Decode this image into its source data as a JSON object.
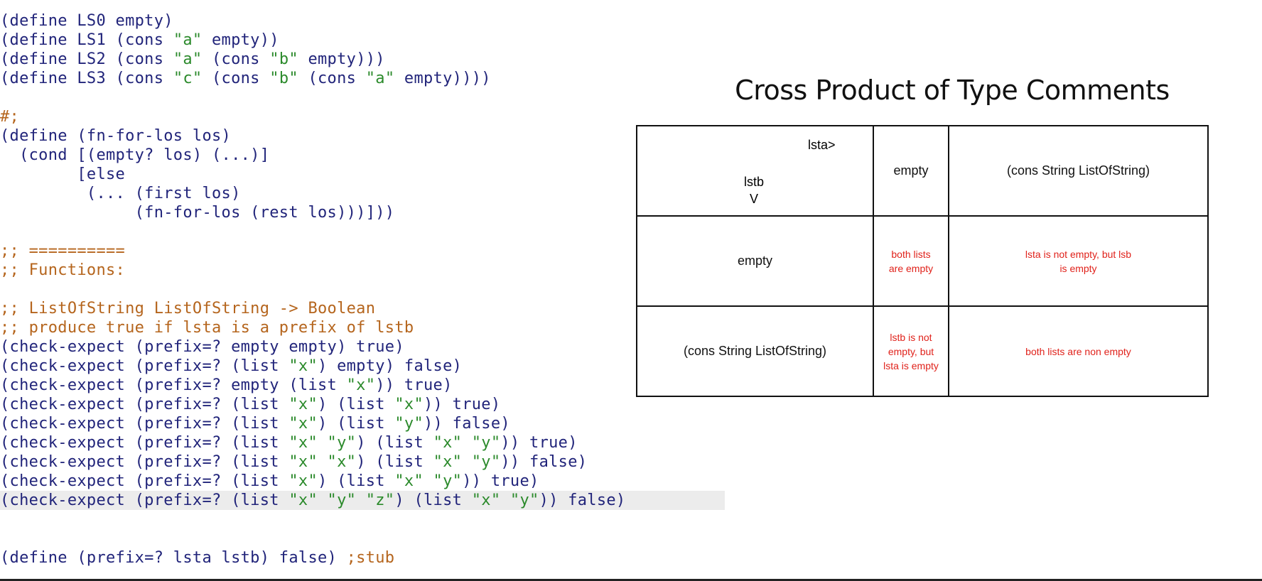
{
  "editor": {
    "lines": [
      [
        {
          "t": "(define LS0 empty)",
          "k": "n"
        }
      ],
      [
        {
          "t": "(define LS1 (cons ",
          "k": "n"
        },
        {
          "t": "\"a\"",
          "k": "s"
        },
        {
          "t": " empty))",
          "k": "n"
        }
      ],
      [
        {
          "t": "(define LS2 (cons ",
          "k": "n"
        },
        {
          "t": "\"a\"",
          "k": "s"
        },
        {
          "t": " (cons ",
          "k": "n"
        },
        {
          "t": "\"b\"",
          "k": "s"
        },
        {
          "t": " empty)))",
          "k": "n"
        }
      ],
      [
        {
          "t": "(define LS3 (cons ",
          "k": "n"
        },
        {
          "t": "\"c\"",
          "k": "s"
        },
        {
          "t": " (cons ",
          "k": "n"
        },
        {
          "t": "\"b\"",
          "k": "s"
        },
        {
          "t": " (cons ",
          "k": "n"
        },
        {
          "t": "\"a\"",
          "k": "s"
        },
        {
          "t": " empty))))",
          "k": "n"
        }
      ],
      [],
      [
        {
          "t": "#;",
          "k": "c"
        }
      ],
      [
        {
          "t": "(define (fn-for-los los)",
          "k": "n"
        }
      ],
      [
        {
          "t": "  (cond [(empty? los) (...)]",
          "k": "n"
        }
      ],
      [
        {
          "t": "        [else",
          "k": "n"
        }
      ],
      [
        {
          "t": "         (... (first los)",
          "k": "n"
        }
      ],
      [
        {
          "t": "              (fn-for-los (rest los)))]))",
          "k": "n"
        }
      ],
      [],
      [
        {
          "t": ";; ==========",
          "k": "c"
        }
      ],
      [
        {
          "t": ";; Functions:",
          "k": "c"
        }
      ],
      [],
      [
        {
          "t": ";; ListOfString ListOfString -> Boolean",
          "k": "c"
        }
      ],
      [
        {
          "t": ";; produce true if lsta is a prefix of lstb",
          "k": "c"
        }
      ],
      [
        {
          "t": "(check-expect (prefix=? empty empty) true)",
          "k": "n"
        }
      ],
      [
        {
          "t": "(check-expect (prefix=? (list ",
          "k": "n"
        },
        {
          "t": "\"x\"",
          "k": "s"
        },
        {
          "t": ") empty) false)",
          "k": "n"
        }
      ],
      [
        {
          "t": "(check-expect (prefix=? empty (list ",
          "k": "n"
        },
        {
          "t": "\"x\"",
          "k": "s"
        },
        {
          "t": ")) true)",
          "k": "n"
        }
      ],
      [
        {
          "t": "(check-expect (prefix=? (list ",
          "k": "n"
        },
        {
          "t": "\"x\"",
          "k": "s"
        },
        {
          "t": ") (list ",
          "k": "n"
        },
        {
          "t": "\"x\"",
          "k": "s"
        },
        {
          "t": ")) true)",
          "k": "n"
        }
      ],
      [
        {
          "t": "(check-expect (prefix=? (list ",
          "k": "n"
        },
        {
          "t": "\"x\"",
          "k": "s"
        },
        {
          "t": ") (list ",
          "k": "n"
        },
        {
          "t": "\"y\"",
          "k": "s"
        },
        {
          "t": ")) false)",
          "k": "n"
        }
      ],
      [
        {
          "t": "(check-expect (prefix=? (list ",
          "k": "n"
        },
        {
          "t": "\"x\" \"y\"",
          "k": "s"
        },
        {
          "t": ") (list ",
          "k": "n"
        },
        {
          "t": "\"x\" \"y\"",
          "k": "s"
        },
        {
          "t": ")) true)",
          "k": "n"
        }
      ],
      [
        {
          "t": "(check-expect (prefix=? (list ",
          "k": "n"
        },
        {
          "t": "\"x\" \"x\"",
          "k": "s"
        },
        {
          "t": ") (list ",
          "k": "n"
        },
        {
          "t": "\"x\" \"y\"",
          "k": "s"
        },
        {
          "t": ")) false)",
          "k": "n"
        }
      ],
      [
        {
          "t": "(check-expect (prefix=? (list ",
          "k": "n"
        },
        {
          "t": "\"x\"",
          "k": "s"
        },
        {
          "t": ") (list ",
          "k": "n"
        },
        {
          "t": "\"x\" \"y\"",
          "k": "s"
        },
        {
          "t": ")) true)",
          "k": "n"
        }
      ],
      [
        {
          "t": "(check-expect (prefix=? (list ",
          "k": "n"
        },
        {
          "t": "\"x\" \"y\" \"z\"",
          "k": "s"
        },
        {
          "t": ") (list ",
          "k": "n"
        },
        {
          "t": "\"x\" \"y\"",
          "k": "s"
        },
        {
          "t": ")) false)",
          "k": "n"
        }
      ],
      [],
      [],
      [
        {
          "t": "(define (prefix=? lsta lstb) false) ",
          "k": "n"
        },
        {
          "t": ";stub",
          "k": "c"
        }
      ]
    ],
    "highlighted_line": 25,
    "colors": {
      "normal": "#21247a",
      "string": "#2b8a2b",
      "comment": "#b5651d",
      "highlight": "#ececec"
    }
  },
  "slide": {
    "title": "Cross Product of Type Comments",
    "corner_top": "lsta>",
    "corner_left": "lstb",
    "corner_arrow": "V",
    "col_headers": [
      "empty",
      "(cons String ListOfString)"
    ],
    "row_headers": [
      "empty",
      "(cons String ListOfString)"
    ],
    "cells": [
      [
        "both lists are empty",
        "lsta is not empty, but lsb is empty"
      ],
      [
        "lstb is not empty, but lsta is empty",
        "both lists are non empty"
      ]
    ],
    "cell_color": "#e0221b"
  }
}
